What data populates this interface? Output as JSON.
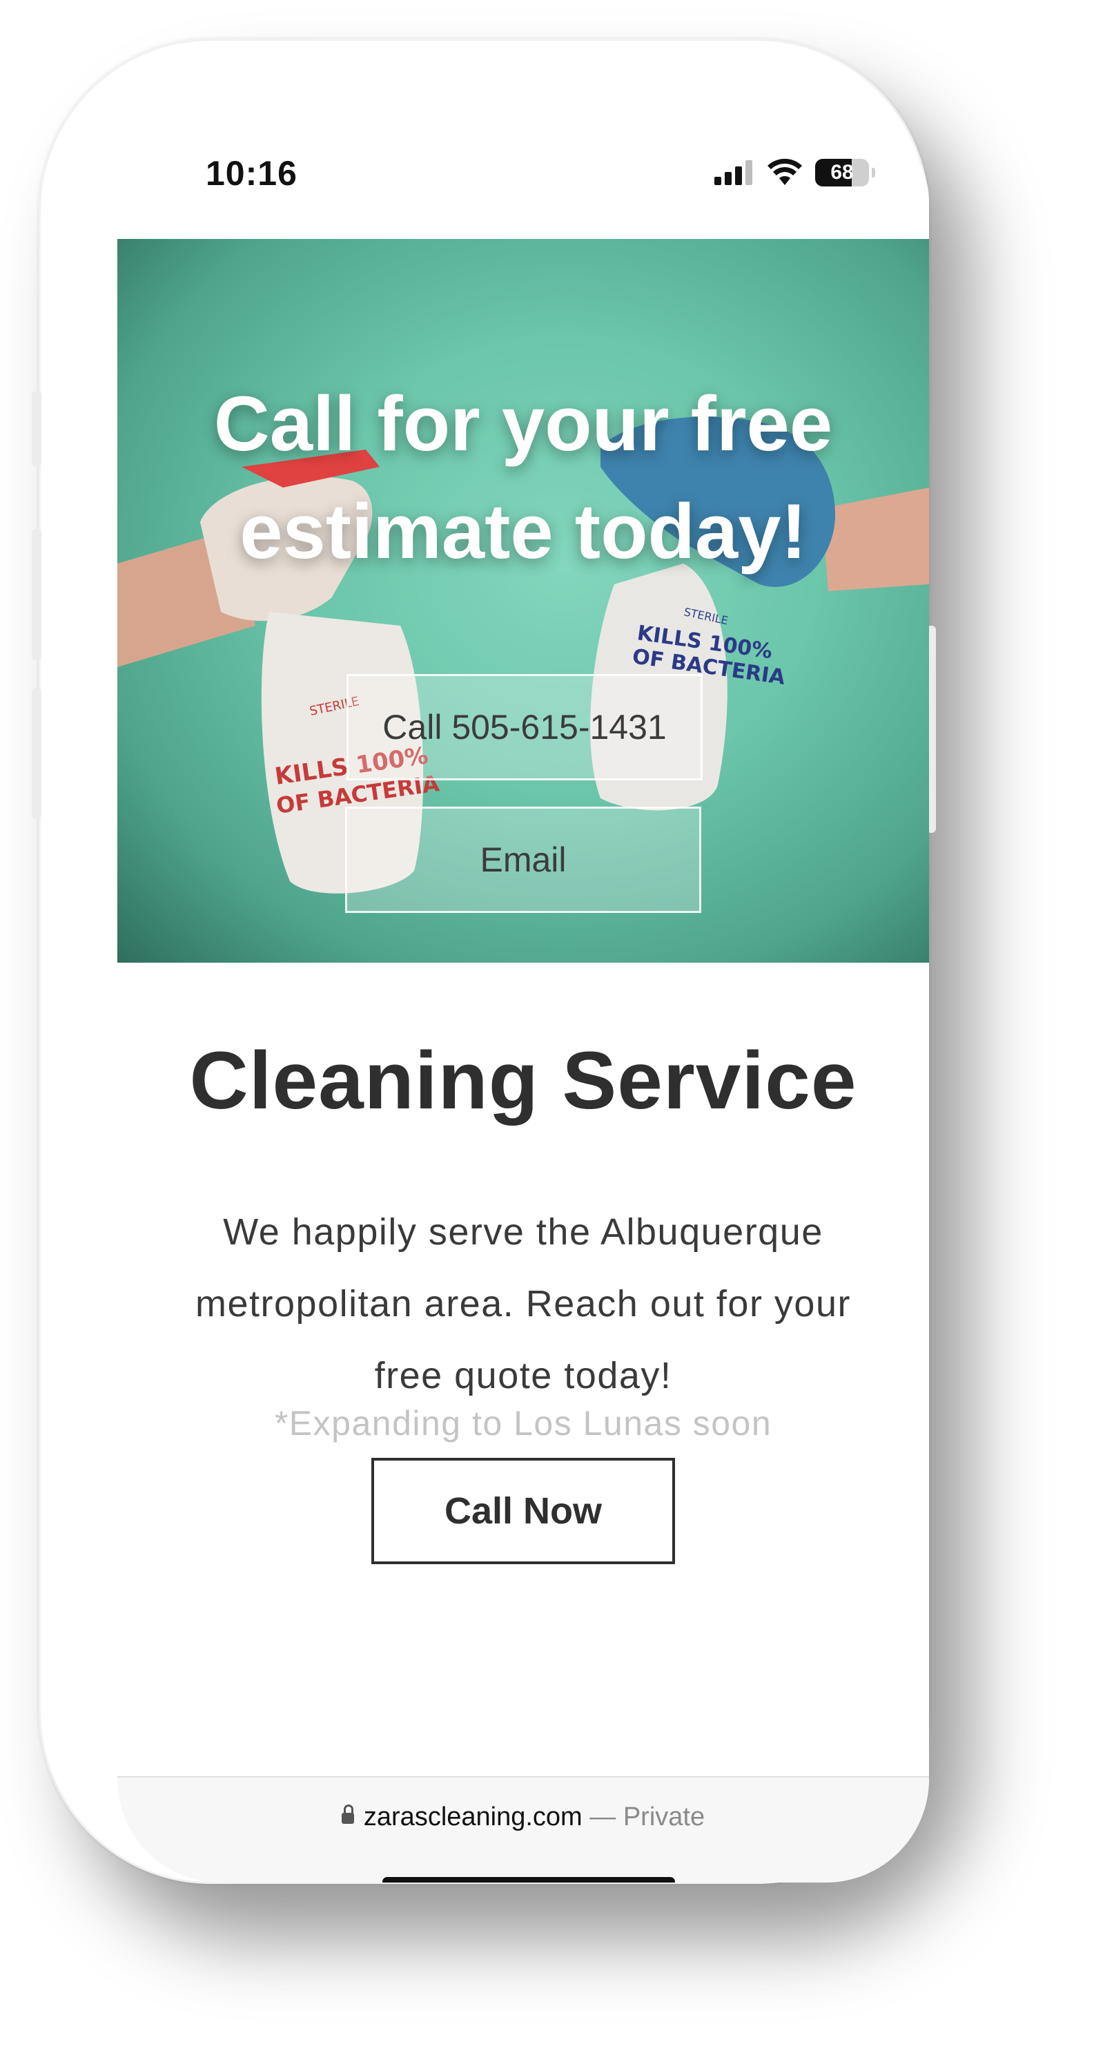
{
  "status_bar": {
    "time": "10:16",
    "battery": "68",
    "battery_level": 0.68
  },
  "hero": {
    "title_line1": "Call for your free",
    "title_line2": "estimate today!",
    "call_button": "Call 505-615-1431",
    "email_button": "Email",
    "bottle_left_brand": "STERILE",
    "bottle_left_line1": "KILLS 100%",
    "bottle_left_line2": "OF BACTERIA",
    "bottle_right_brand": "STERILE",
    "bottle_right_line1": "KILLS 100%",
    "bottle_right_line2": "OF BACTERIA"
  },
  "content": {
    "title": "Cleaning Service",
    "description": "We happily serve the Albuquerque metropolitan  area. Reach out for your free quote today!",
    "note": "*Expanding to Los Lunas soon",
    "cta": "Call Now"
  },
  "browser": {
    "domain": "zarascleaning.com",
    "suffix": " — Private"
  },
  "icons": [
    "cellular-signal-icon",
    "wifi-icon",
    "battery-icon",
    "lock-icon"
  ]
}
